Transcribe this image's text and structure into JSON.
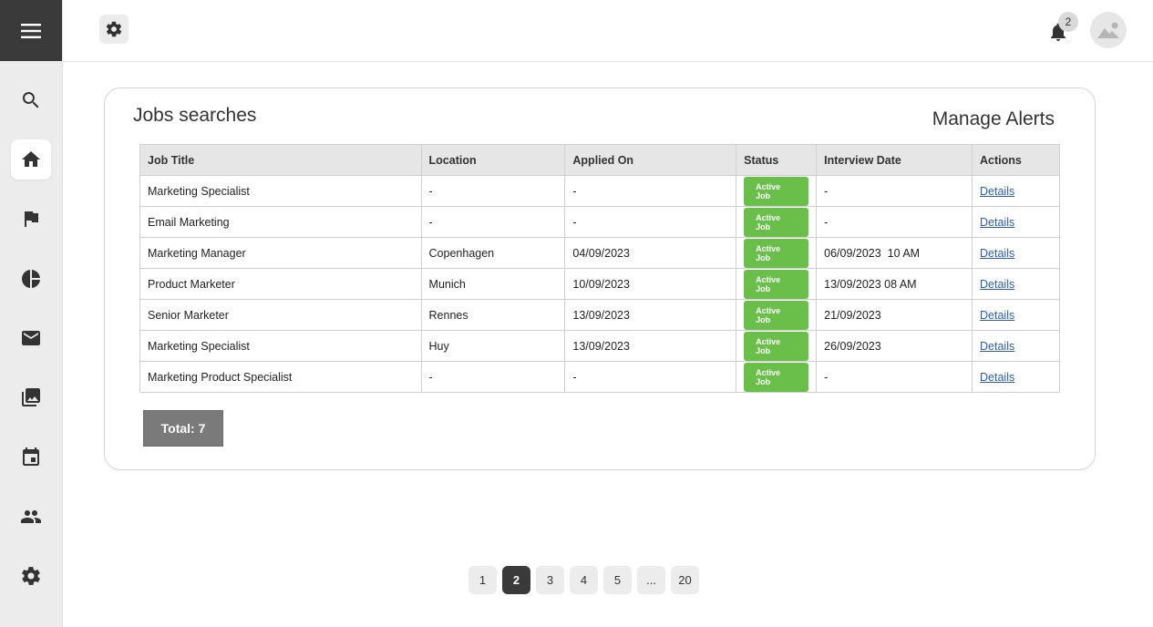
{
  "sidebar": {
    "items": [
      {
        "icon": "search-icon"
      },
      {
        "icon": "home-icon",
        "active": true
      },
      {
        "icon": "flag-icon"
      },
      {
        "icon": "pie-chart-icon"
      },
      {
        "icon": "mail-icon"
      },
      {
        "icon": "photos-icon"
      },
      {
        "icon": "calendar-icon"
      },
      {
        "icon": "people-icon"
      },
      {
        "icon": "settings-icon"
      }
    ]
  },
  "topbar": {
    "notification_count": "2"
  },
  "card": {
    "title": "Jobs searches",
    "manage_alerts": "Manage Alerts",
    "total_label": "Total: 7"
  },
  "table": {
    "headers": [
      "Job Title",
      "Location",
      "Applied On",
      "Status",
      "Interview Date",
      "Actions"
    ],
    "rows": [
      [
        "Marketing Specialist",
        "-",
        "-",
        "Active Job",
        "-",
        "Details"
      ],
      [
        "Email Marketing",
        "-",
        "-",
        "Active Job",
        "-",
        "Details"
      ],
      [
        "Marketing Manager",
        "Copenhagen",
        "04/09/2023",
        "Active Job",
        "06/09/2023  10 AM",
        "Details"
      ],
      [
        "Product Marketer",
        "Munich",
        "10/09/2023",
        "Active Job",
        "13/09/2023 08 AM",
        "Details"
      ],
      [
        "Senior Marketer",
        "Rennes",
        "13/09/2023",
        "Active Job",
        "21/09/2023",
        "Details"
      ],
      [
        "Marketing Specialist",
        "Huy",
        "13/09/2023",
        "Active Job",
        "26/09/2023",
        "Details"
      ],
      [
        "Marketing Product Specialist",
        "-",
        "-",
        "Active Job",
        "-",
        "Details"
      ]
    ]
  },
  "pagination": {
    "pages": [
      "1",
      "2",
      "3",
      "4",
      "5",
      "...",
      "20"
    ],
    "current": "2"
  },
  "colors": {
    "sidebar_bg": "#ececec",
    "menu_bg": "#3a3a3a",
    "status_green": "#6abf4b",
    "link_blue": "#2a5db0"
  }
}
